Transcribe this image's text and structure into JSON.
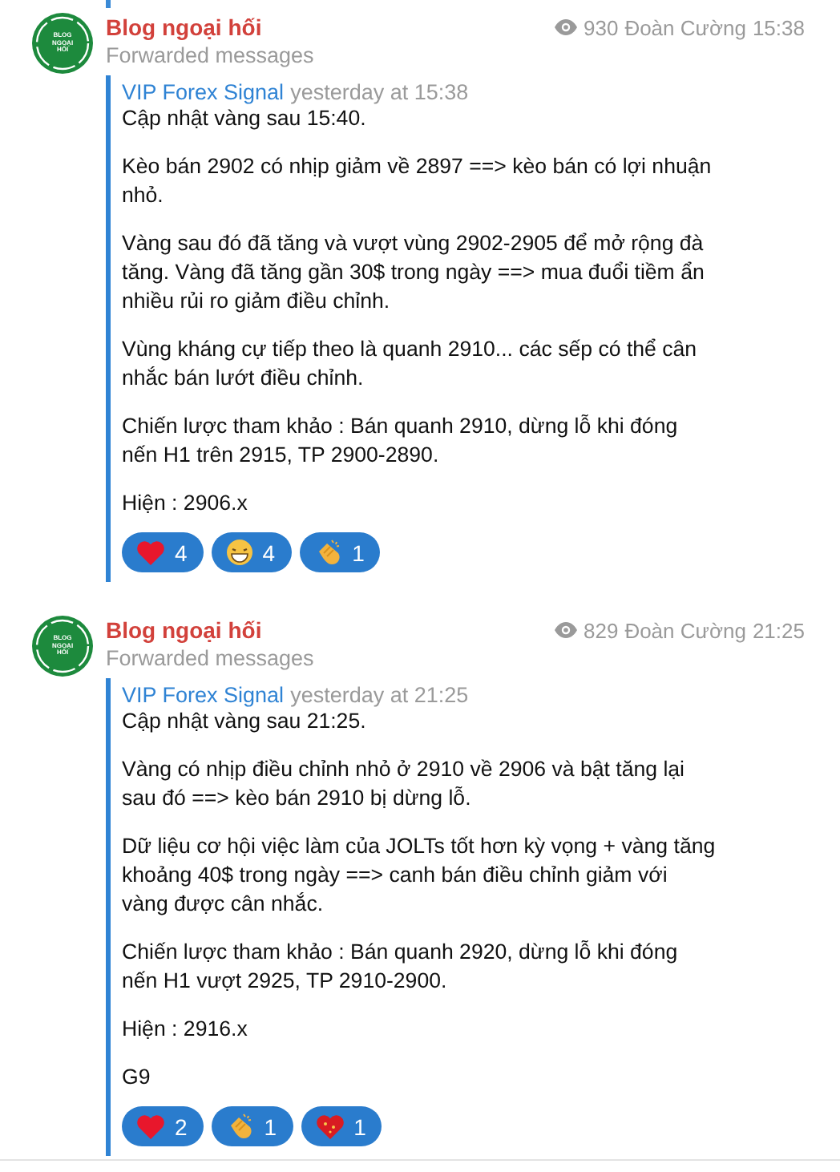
{
  "messages": [
    {
      "channel": "Blog ngoại hối",
      "avatar_text": "BLOG NGOẠI HỐI",
      "subtitle": "Forwarded messages",
      "views": "930",
      "author": "Đoàn Cường",
      "time": "15:38",
      "forward": {
        "source": "VIP Forex Signal",
        "date": "yesterday at 15:38",
        "paragraphs": [
          "Cập nhật vàng sau 15:40.",
          "Kèo bán 2902 có nhịp giảm về 2897 ==> kèo bán có lợi nhuận nhỏ.",
          "Vàng sau đó đã tăng và vượt vùng 2902-2905 để mở rộng đà tăng. Vàng đã tăng gần 30$ trong ngày ==> mua đuổi tiềm ẩn nhiều rủi ro giảm điều chỉnh.",
          "Vùng kháng cự tiếp theo là quanh 2910... các sếp có thể cân nhắc bán lướt điều chỉnh.",
          "Chiến lược tham khảo : Bán quanh 2910, dừng lỗ khi đóng nến H1 trên 2915, TP 2900-2890.",
          "Hiện : 2906.x"
        ]
      },
      "reactions": [
        {
          "kind": "heart",
          "count": "4"
        },
        {
          "kind": "grin",
          "count": "4"
        },
        {
          "kind": "clap",
          "count": "1"
        }
      ]
    },
    {
      "channel": "Blog ngoại hối",
      "avatar_text": "BLOG NGOẠI HỐI",
      "subtitle": "Forwarded messages",
      "views": "829",
      "author": "Đoàn Cường",
      "time": "21:25",
      "forward": {
        "source": "VIP Forex Signal",
        "date": "yesterday at 21:25",
        "paragraphs": [
          "Cập nhật vàng sau 21:25.",
          "Vàng có nhịp điều chỉnh nhỏ ở 2910 về 2906 và bật tăng lại sau đó ==> kèo bán 2910 bị dừng lỗ.",
          "Dữ liệu cơ hội việc làm của JOLTs tốt hơn kỳ vọng + vàng tăng khoảng 40$ trong ngày ==> canh bán điều chỉnh giảm với vàng được cân nhắc.",
          "Chiến lược tham khảo : Bán quanh 2920, dừng lỗ khi đóng nến H1 vượt 2925, TP 2910-2900.",
          "Hiện : 2916.x",
          "G9"
        ]
      },
      "reactions": [
        {
          "kind": "heart",
          "count": "2"
        },
        {
          "kind": "clap",
          "count": "1"
        },
        {
          "kind": "sparkle-heart",
          "count": "1"
        }
      ]
    }
  ]
}
